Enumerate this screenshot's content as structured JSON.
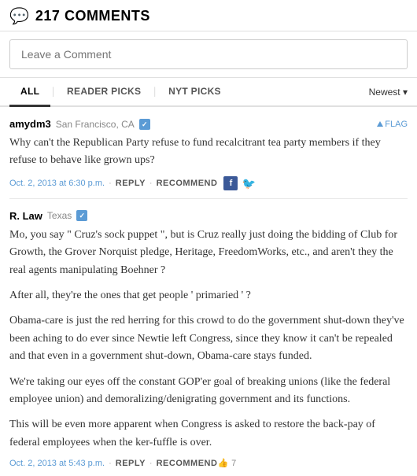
{
  "header": {
    "icon": "💬",
    "title": "217 COMMENTS"
  },
  "comment_input": {
    "placeholder": "Leave a Comment"
  },
  "tabs": {
    "items": [
      {
        "label": "ALL",
        "active": true
      },
      {
        "label": "READER PICKS",
        "active": false
      },
      {
        "label": "NYT PICKS",
        "active": false
      }
    ],
    "sort_label": "Newest",
    "sort_arrow": "▾"
  },
  "comments": [
    {
      "author": "amydm3",
      "location": "San Francisco, CA",
      "verified": true,
      "flag_label": "FLAG",
      "text_paragraphs": [
        "Why can't the Republican Party refuse to fund recalcitrant tea party members if they refuse to behave like grown ups?"
      ],
      "date": "Oct. 2, 2013 at 6:30 p.m.",
      "reply_label": "REPLY",
      "recommend_label": "RECOMMEND",
      "show_social": true,
      "recommend_count": null
    },
    {
      "author": "R. Law",
      "location": "Texas",
      "verified": true,
      "flag_label": null,
      "text_paragraphs": [
        "Mo, you say \" Cruz's sock puppet \", but is Cruz really just doing the bidding of Club for Growth, the Grover Norquist pledge, Heritage, FreedomWorks, etc., and aren't they the real agents manipulating Boehner ?",
        "After all, they're the ones that get people ' primaried ' ?",
        "Obama-care is just the red herring for this crowd to do the government shut-down they've been aching to do ever since Newtie left Congress, since they know it can't be repealed and that even in a government shut-down, Obama-care stays funded.",
        "We're taking our eyes off the constant GOP'er goal of breaking unions (like the federal employee union) and demoralizing/denigrating government and its functions.",
        "This will be even more apparent when Congress is asked to restore the back-pay of federal employees when the ker-fuffle is over."
      ],
      "date": "Oct. 2, 2013 at 5:43 p.m.",
      "reply_label": "REPLY",
      "recommend_label": "RECOMMEND",
      "show_social": false,
      "recommend_count": "7"
    }
  ]
}
